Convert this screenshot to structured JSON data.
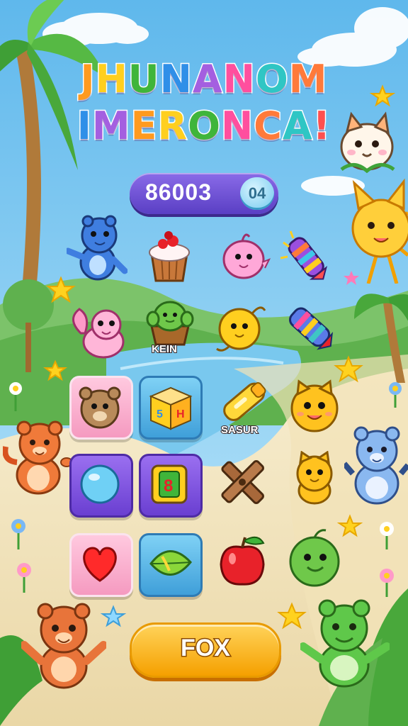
{
  "title": {
    "line1": [
      "J",
      "H",
      "U",
      "N",
      "A",
      "N",
      "O",
      "M"
    ],
    "line2": [
      "I",
      "M",
      "E",
      "R",
      "O",
      "N",
      "C",
      "A",
      "!"
    ],
    "line1_colors": [
      "#ff9a1f",
      "#ffcf1f",
      "#3fb53a",
      "#2f8fe8",
      "#a45fe0",
      "#ff4f9e",
      "#2fc6c4",
      "#ff7a3a"
    ],
    "line2_colors": [
      "#2f8fe8",
      "#a45fe0",
      "#ff9a1f",
      "#ffcf1f",
      "#3fb53a",
      "#ff4f9e",
      "#ff7a3a",
      "#2fc6c4",
      "#ff4f4f"
    ]
  },
  "hud": {
    "score": "86003",
    "level": "04"
  },
  "board": {
    "row1": [
      "blue-bear",
      "cupcake",
      "pink-bird",
      "firework-rocket"
    ],
    "row2": [
      "pink-squirrel",
      "cactus-pot",
      "yellow-chick",
      "firework-rocket-2"
    ],
    "row2_labels": {
      "cactus_pot": "KEIN"
    },
    "row3": [
      "brown-bear-tile",
      "toy-block-tile",
      "yellow-whistle",
      "yellow-cat-face"
    ],
    "row3_labels": {
      "whistle": "SASUR"
    },
    "row4": [
      "blue-bubble-tile",
      "number-block-tile",
      "wooden-cross",
      "yellow-cat"
    ],
    "row5": [
      "red-heart-tile",
      "green-leaf-tile",
      "red-apple",
      "green-blob"
    ]
  },
  "action": {
    "button_label": "FOX"
  },
  "colors": {
    "sky": "#8fd3f5",
    "sand": "#f3e6bf",
    "water": "#79c8ee",
    "button": "#f5a000",
    "score_pill": "#6a4fd4"
  }
}
